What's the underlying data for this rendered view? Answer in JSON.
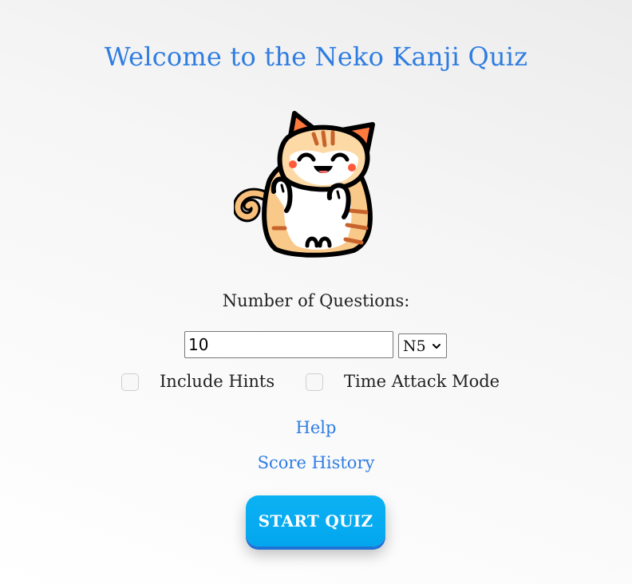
{
  "page": {
    "title": "Welcome to the Neko Kanji Quiz"
  },
  "mascot": {
    "icon": "cat-mascot-icon"
  },
  "form": {
    "questions_label": "Number of Questions:",
    "questions_value": "10",
    "level_selected": "N5",
    "include_hints_label": "Include Hints",
    "include_hints_checked": false,
    "time_attack_label": "Time Attack Mode",
    "time_attack_checked": false
  },
  "links": {
    "help": "Help",
    "score_history": "Score History"
  },
  "actions": {
    "start_label": "START QUIZ"
  },
  "colors": {
    "accent": "#2f7de1",
    "button": "#03a6ee",
    "button_shadow": "#1f73d6"
  }
}
